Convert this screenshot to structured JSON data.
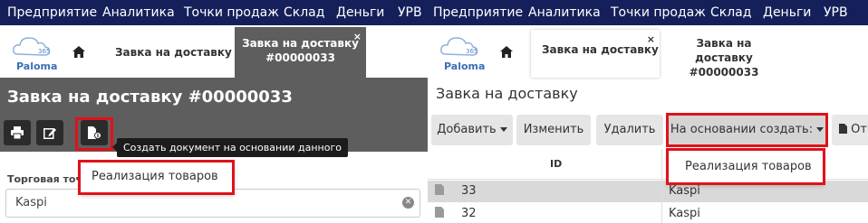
{
  "left": {
    "nav": [
      "Предприятие",
      "Аналитика",
      "Точки продаж",
      "Склад",
      "Деньги",
      "УРВ"
    ],
    "logo": {
      "text": "Paloma",
      "number": "365"
    },
    "tabs": [
      {
        "label": "Завка на доставку"
      },
      {
        "label_line1": "Завка на доставку",
        "label_line2": "#00000033",
        "close": "×"
      }
    ],
    "doc_title": "Завка на доставку #00000033",
    "toolbar_icons": [
      "print-icon",
      "edit-icon",
      "create-based-on-icon"
    ],
    "tooltip": "Создать документ на основании данного",
    "dropdown_item": "Реализация товаров",
    "field_label": "Торговая точ",
    "field_value": "Kaspi"
  },
  "right": {
    "nav": [
      "Предприятие",
      "Аналитика",
      "Точки продаж",
      "Склад",
      "Деньги",
      "УРВ"
    ],
    "logo": {
      "text": "Paloma",
      "number": "365"
    },
    "tabs": [
      {
        "label": "Завка на доставку",
        "close": "×"
      },
      {
        "label_line1": "Завка на доставку",
        "label_line2": "#00000033"
      }
    ],
    "page_title": "Завка на доставку",
    "buttons": {
      "add": "Добавить",
      "edit": "Изменить",
      "delete": "Удалить",
      "create_based": "На основании создать:",
      "report": "Отч"
    },
    "dropdown_item": "Реализация товаров",
    "columns": {
      "id": "ID"
    },
    "rows": [
      {
        "id": "33",
        "point": "Kaspi"
      },
      {
        "id": "32",
        "point": "Kaspi"
      }
    ]
  },
  "colors": {
    "topnav": "#15205a",
    "dark_header": "#5e5e5e",
    "highlight": "#e0121b",
    "selected_row": "#d9d9d9"
  }
}
